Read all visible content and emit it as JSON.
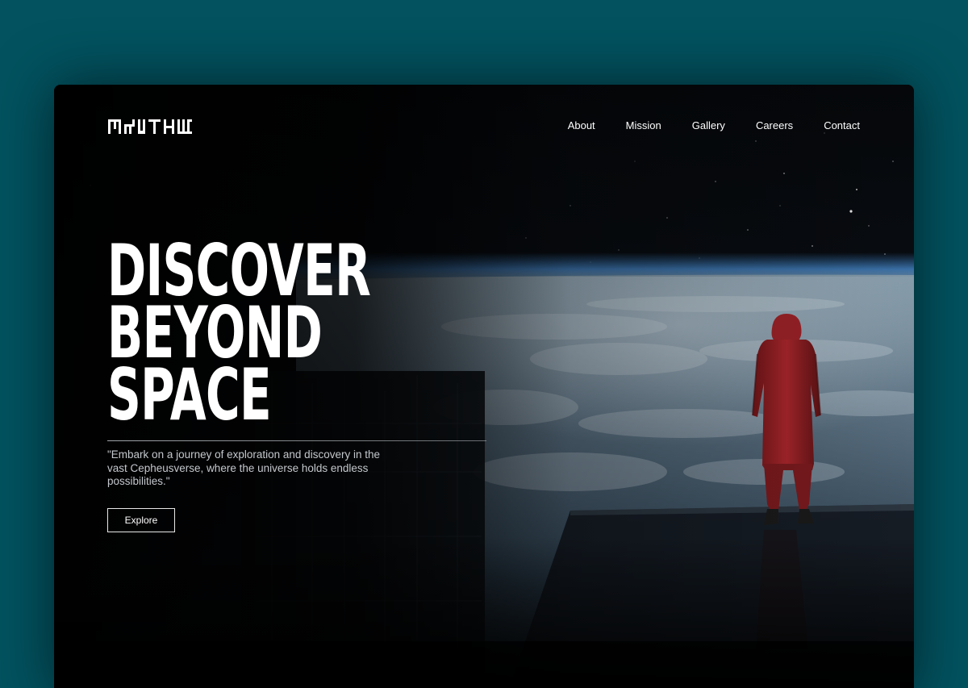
{
  "brand": {
    "logo_text": "MYTHU"
  },
  "nav": {
    "items": [
      {
        "label": "About"
      },
      {
        "label": "Mission"
      },
      {
        "label": "Gallery"
      },
      {
        "label": "Careers"
      },
      {
        "label": "Contact"
      }
    ]
  },
  "hero": {
    "title_lines": [
      "DISCOVER",
      "BEYOND",
      "SPACE"
    ],
    "tagline": "\"Embark on a journey of exploration and discovery in the vast Cepheusverse, where the universe holds endless possibilities.\"",
    "cta_label": "Explore"
  },
  "colors": {
    "page_background": "#02525f",
    "frame_background": "#050608",
    "accent_red": "#a8262b",
    "text_primary": "#ffffff",
    "text_secondary": "#c4c8cc"
  }
}
